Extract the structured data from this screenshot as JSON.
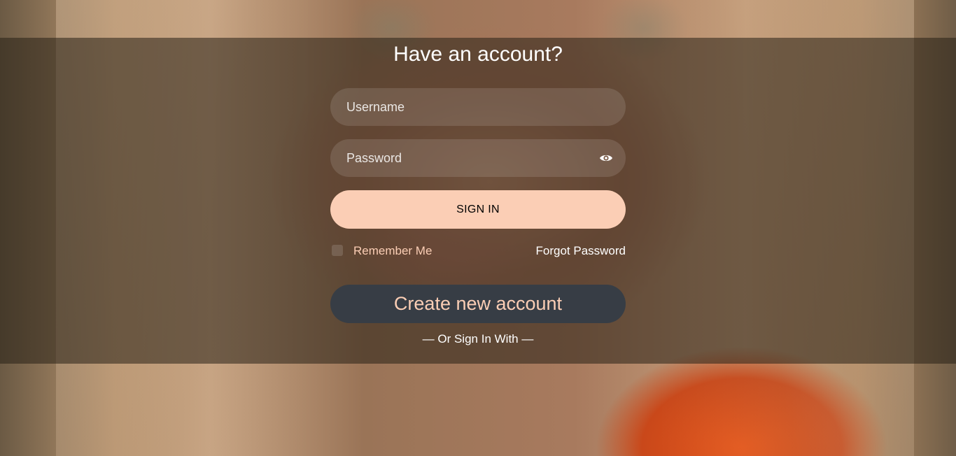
{
  "login": {
    "title": "Have an account?",
    "username_placeholder": "Username",
    "password_placeholder": "Password",
    "signin_label": "SIGN IN",
    "remember_label": "Remember Me",
    "remember_checked": false,
    "forgot_label": "Forgot Password",
    "create_label": "Create new account",
    "or_text": "— Or Sign In With —"
  },
  "icons": {
    "password_toggle": "eye-icon"
  },
  "colors": {
    "accent_peach": "#fbceb5",
    "create_button": "#373d45",
    "overlay": "rgba(40,32,22,0.55)"
  }
}
